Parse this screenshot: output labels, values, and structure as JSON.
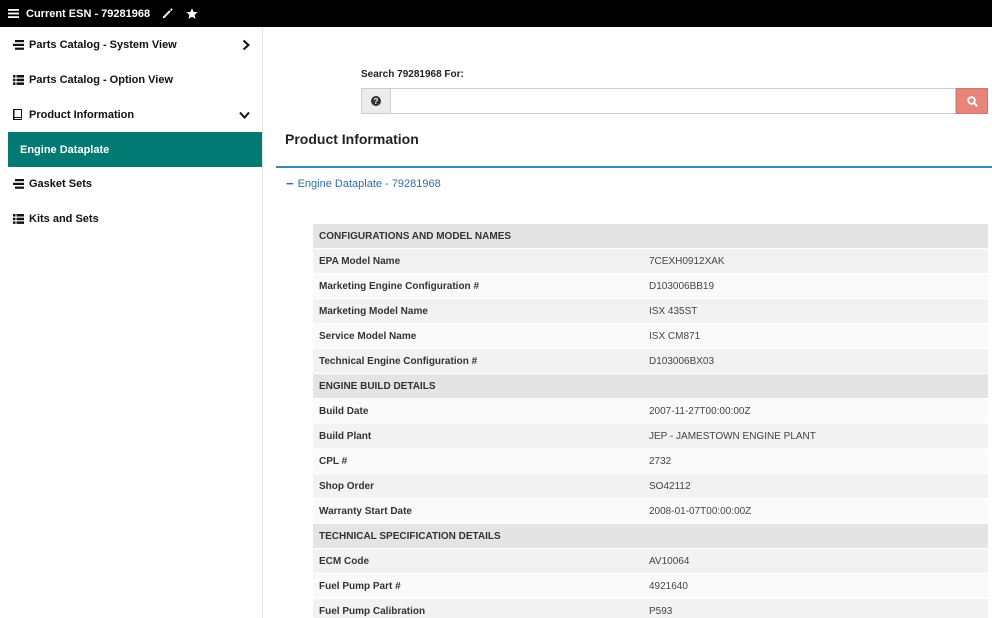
{
  "topbar": {
    "title": "Current ESN - 79281968",
    "menu_icon": "hamburger-icon",
    "edit_icon": "pencil-icon",
    "favorite_icon": "star-icon"
  },
  "sidebar": {
    "items": [
      {
        "label": "Parts Catalog - System View",
        "icon": "stack-icon",
        "chevron": "right"
      },
      {
        "label": "Parts Catalog - Option View",
        "icon": "list-icon"
      },
      {
        "label": "Product Information",
        "icon": "book-icon",
        "chevron": "down"
      },
      {
        "label": "Engine Dataplate",
        "active": true
      },
      {
        "label": "Gasket Sets",
        "icon": "stack-icon"
      },
      {
        "label": "Kits and Sets",
        "icon": "list-icon"
      }
    ]
  },
  "search": {
    "label": "Search 79281968 For:",
    "value": "",
    "placeholder": ""
  },
  "main": {
    "section_title": "Product Information",
    "expander_label": "Engine Dataplate - 79281968"
  },
  "table": {
    "rows": [
      {
        "type": "header",
        "label": "CONFIGURATIONS AND MODEL NAMES"
      },
      {
        "type": "data",
        "key": "EPA Model Name",
        "value": "7CEXH0912XAK"
      },
      {
        "type": "data",
        "key": "Marketing Engine Configuration #",
        "value": "D103006BB19"
      },
      {
        "type": "data",
        "key": "Marketing Model Name",
        "value": "ISX 435ST"
      },
      {
        "type": "data",
        "key": "Service Model Name",
        "value": "ISX CM871"
      },
      {
        "type": "data",
        "key": "Technical Engine Configuration #",
        "value": "D103006BX03"
      },
      {
        "type": "header",
        "label": "ENGINE BUILD DETAILS"
      },
      {
        "type": "data",
        "key": "Build Date",
        "value": "2007-11-27T00:00:00Z"
      },
      {
        "type": "data",
        "key": "Build Plant",
        "value": "JEP - JAMESTOWN ENGINE PLANT"
      },
      {
        "type": "data",
        "key": "CPL #",
        "value": "2732"
      },
      {
        "type": "data",
        "key": "Shop Order",
        "value": "SO42112"
      },
      {
        "type": "data",
        "key": "Warranty Start Date",
        "value": "2008-01-07T00:00:00Z"
      },
      {
        "type": "header",
        "label": "TECHNICAL SPECIFICATION DETAILS"
      },
      {
        "type": "data",
        "key": "ECM Code",
        "value": "AV10064"
      },
      {
        "type": "data",
        "key": "Fuel Pump Part #",
        "value": "4921640"
      },
      {
        "type": "data",
        "key": "Fuel Pump Calibration",
        "value": "P593"
      }
    ]
  },
  "colors": {
    "topbar_bg": "#000000",
    "active_nav_bg": "#007a73",
    "divider": "#3b86b4",
    "link": "#2f6ea8",
    "search_button": "#e8857a"
  }
}
